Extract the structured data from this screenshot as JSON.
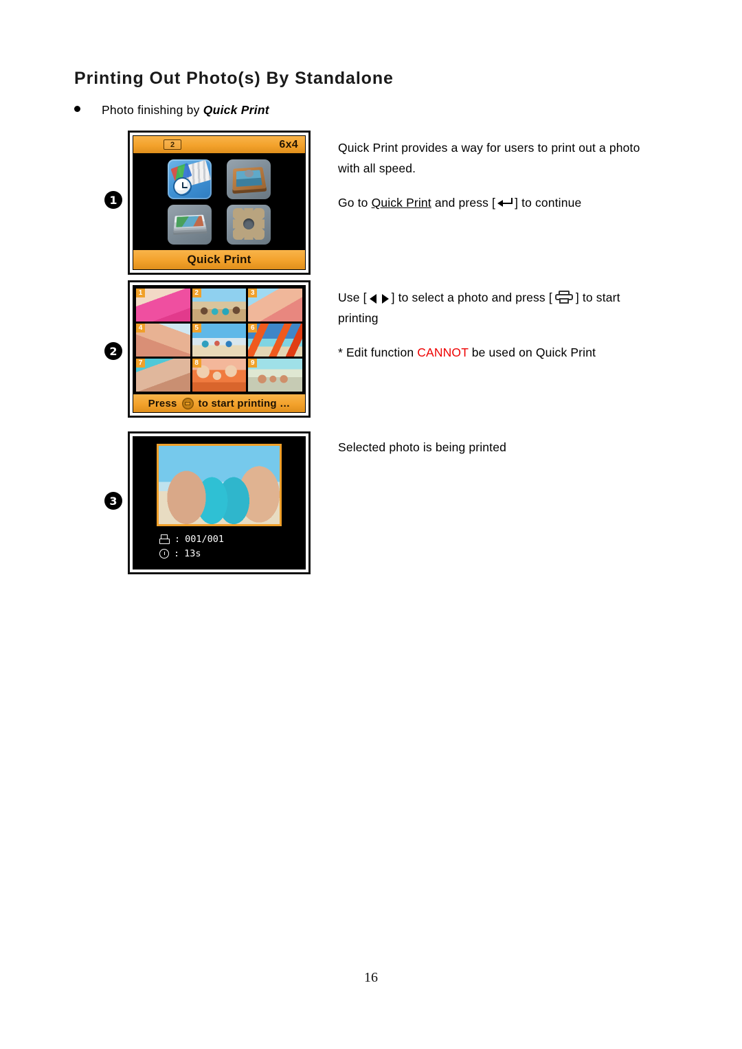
{
  "document": {
    "title": "Printing Out Photo(s) By Standalone",
    "bullet_prefix": "Photo finishing by ",
    "bullet_emphasis": "Quick Print",
    "page_number": "16"
  },
  "colors": {
    "accent_orange": "#f0a02a",
    "warning_red": "#ee0000",
    "screen_black": "#000000"
  },
  "steps": [
    {
      "number": "1",
      "screen": {
        "name": "quick-print-menu",
        "topbar": {
          "media_badge": "2",
          "paper_size": "6x4"
        },
        "tiles": [
          {
            "label": "quick-print",
            "selected": true
          },
          {
            "label": "photo-frame",
            "selected": false
          },
          {
            "label": "photo-stack",
            "selected": false
          },
          {
            "label": "settings-gear",
            "selected": false
          }
        ],
        "bottom_label": "Quick Print"
      },
      "copy": {
        "para1": "Quick Print provides a way for users to print out a photo with all speed.",
        "para2_a": "Go to ",
        "para2_underlined": "Quick Print",
        "para2_b": " and press [",
        "para2_c": "] to continue"
      }
    },
    {
      "number": "2",
      "screen": {
        "name": "photo-thumbnail-grid",
        "thumbnails": [
          {
            "number": "1",
            "selected": false
          },
          {
            "number": "2",
            "selected": true
          },
          {
            "number": "3",
            "selected": false
          },
          {
            "number": "4",
            "selected": false
          },
          {
            "number": "5",
            "selected": false
          },
          {
            "number": "6",
            "selected": false
          },
          {
            "number": "7",
            "selected": false
          },
          {
            "number": "8",
            "selected": false
          },
          {
            "number": "9",
            "selected": false
          }
        ],
        "bottom_prefix": "Press",
        "bottom_suffix": "to start printing …"
      },
      "copy": {
        "para1_a": "Use [",
        "para1_b": "] to select a photo and press [",
        "para1_c": "] to start printing",
        "note_prefix": "*  Edit function ",
        "note_warning": "CANNOT",
        "note_suffix": " be used on Quick Print"
      }
    },
    {
      "number": "3",
      "screen": {
        "name": "printing-progress",
        "status": [
          {
            "icon": "printer-icon",
            "separator": ":",
            "value": "001/001"
          },
          {
            "icon": "clock-icon",
            "separator": ":",
            "value": "13s"
          }
        ]
      },
      "copy": {
        "para1": "Selected photo is being printed"
      }
    }
  ]
}
